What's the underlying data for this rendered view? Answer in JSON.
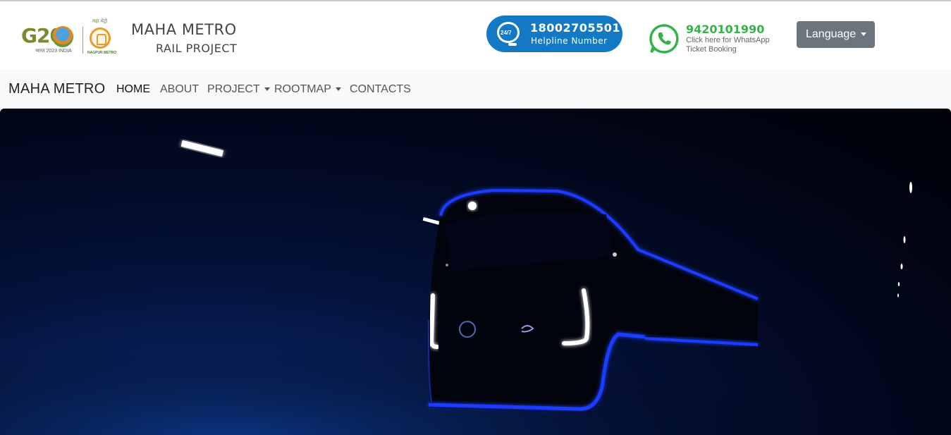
{
  "header": {
    "g20_logo": {
      "text": "G20",
      "tagline": "भारत 2023 INDIA"
    },
    "nagpur_logo": {
      "top_text": "महा मेट्रो",
      "bottom_text": "NAGPUR METRO"
    },
    "brand_line1": "MAHA METRO",
    "brand_line2": "RAIL PROJECT",
    "helpline": {
      "badge": "24/7",
      "number": "18002705501",
      "label": "Helpline Number",
      "icon": "headset-icon"
    },
    "whatsapp": {
      "number": "9420101990",
      "line1": "Click here for WhatsApp",
      "line2": "Ticket Booking",
      "icon": "whatsapp-icon",
      "color": "#35b34a"
    },
    "language_button": "Language"
  },
  "navbar": {
    "brand": "MAHA METRO",
    "items": [
      {
        "label": "HOME",
        "active": true,
        "dropdown": false
      },
      {
        "label": "ABOUT",
        "active": false,
        "dropdown": false
      },
      {
        "label": "PROJECT",
        "active": false,
        "dropdown": true
      },
      {
        "label": "ROOTMAP",
        "active": false,
        "dropdown": true
      },
      {
        "label": "CONTACTS",
        "active": false,
        "dropdown": false
      }
    ]
  },
  "colors": {
    "helpline_bg": "#1479c4",
    "language_btn_bg": "#6c757d",
    "navbar_bg": "#f8f9fa",
    "hero_glow": "#1a3cff"
  }
}
